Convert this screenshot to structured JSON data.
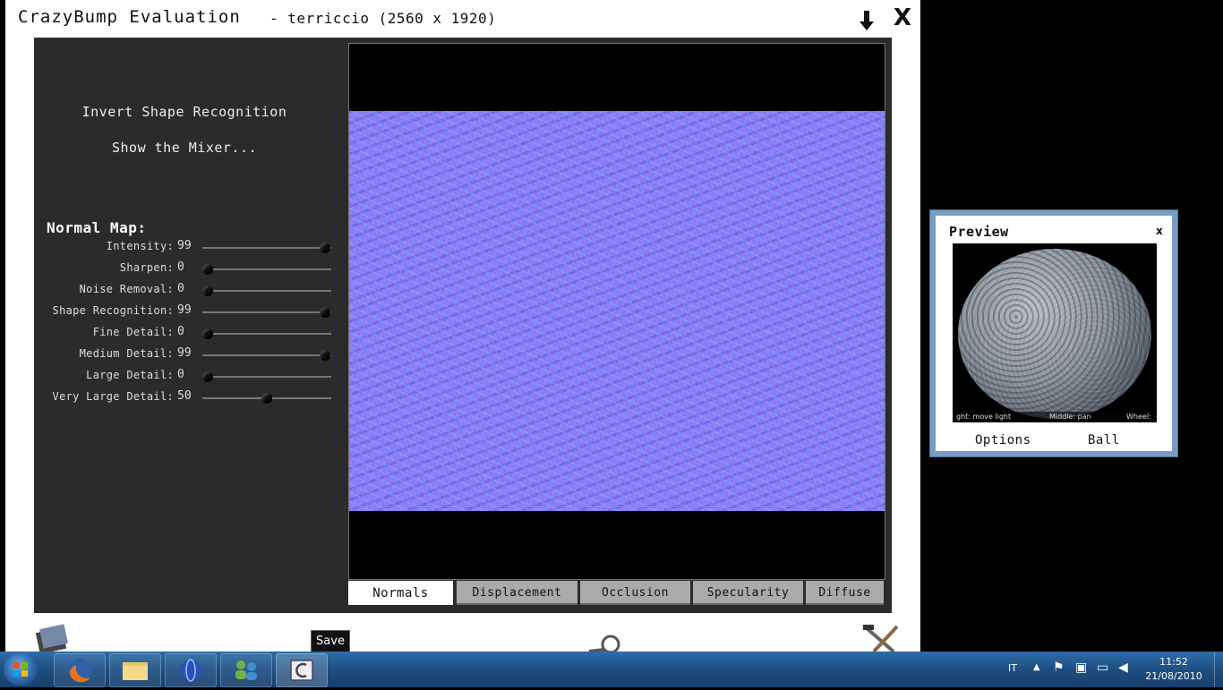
{
  "window": {
    "app_title": "CrazyBump Evaluation",
    "file_info": "- terriccio (2560 x 1920)"
  },
  "left_panel": {
    "invert_label": "Invert Shape Recognition",
    "mixer_label": "Show the Mixer...",
    "section_title": "Normal Map:",
    "sliders": [
      {
        "label": "Intensity:",
        "value": "99",
        "level": 0.99
      },
      {
        "label": "Sharpen:",
        "value": "0",
        "level": 0.0
      },
      {
        "label": "Noise Removal:",
        "value": "0",
        "level": 0.0
      },
      {
        "label": "Shape Recognition:",
        "value": "99",
        "level": 0.99
      },
      {
        "label": "Fine Detail:",
        "value": "0",
        "level": 0.0
      },
      {
        "label": "Medium Detail:",
        "value": "99",
        "level": 0.99
      },
      {
        "label": "Large Detail:",
        "value": "0",
        "level": 0.0
      },
      {
        "label": "Very Large Detail:",
        "value": "50",
        "level": 0.5
      }
    ]
  },
  "tabs": [
    {
      "label": "Normals",
      "active": true
    },
    {
      "label": "Displacement",
      "active": false
    },
    {
      "label": "Occlusion",
      "active": false
    },
    {
      "label": "Specularity",
      "active": false
    },
    {
      "label": "Diffuse",
      "active": false
    }
  ],
  "bottom": {
    "save_tooltip": "Save"
  },
  "preview": {
    "title": "Preview",
    "close": "x",
    "hint_left": "ght: move light",
    "hint_mid": "Middle: pan",
    "hint_right": "Wheel:",
    "options_label": "Options",
    "ball_label": "Ball"
  },
  "taskbar": {
    "language": "IT",
    "time": "11:52",
    "date": "21/08/2010",
    "accent": "#1d4f82"
  }
}
